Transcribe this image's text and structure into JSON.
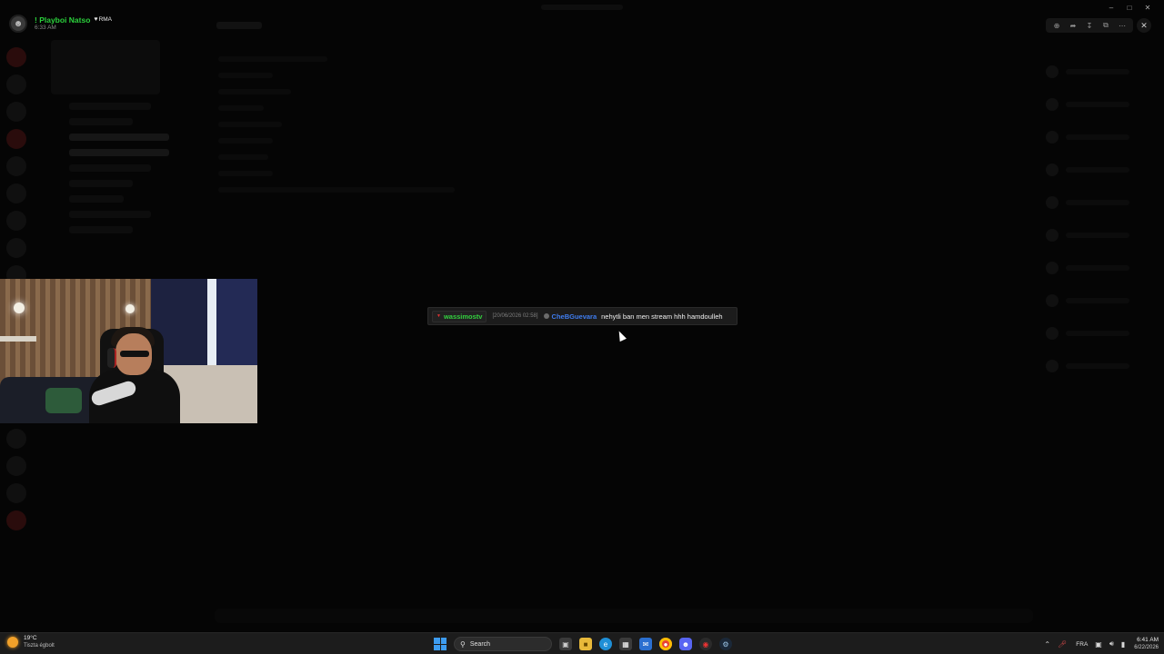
{
  "profile": {
    "name": "! Playboi Natso",
    "badge": "RMA",
    "time": "6:33 AM"
  },
  "chat_message": {
    "channel": "wassimostv",
    "timestamp": "[20/06/2026 02:58]",
    "user": "CheBGuevara",
    "text": "nehytli ban men stream hhh hamdoulleh",
    "colors": {
      "channel": "#33d23f",
      "user": "#3f7df0"
    }
  },
  "viewer_tools": [
    "zoom-icon",
    "share-icon",
    "download-icon",
    "open-external-icon",
    "more-icon"
  ],
  "taskbar": {
    "weather_temp": "19°C",
    "weather_cond": "Tiszta égbolt",
    "search_label": "Search",
    "language": "FRA",
    "time": "6:41 AM",
    "date": "6/22/2026"
  }
}
